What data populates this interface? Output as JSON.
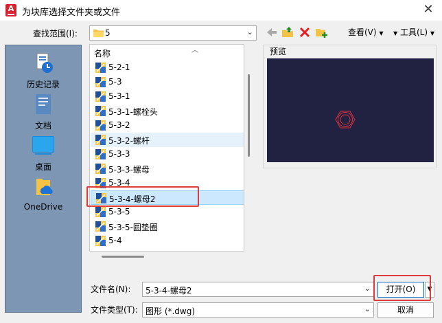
{
  "window": {
    "title": "为块库选择文件夹或文件",
    "app_icon_letter": "A",
    "close_glyph": "✕"
  },
  "toolbar": {
    "lookin_label": "查找范围(I):",
    "lookin_value": "5",
    "view_menu": "查看(V)",
    "tools_menu": "工具(L)",
    "icons": [
      "back-arrow-icon",
      "up-folder-icon",
      "delete-icon",
      "new-folder-icon"
    ]
  },
  "places": [
    {
      "label": "历史记录",
      "icon": "history-icon"
    },
    {
      "label": "文档",
      "icon": "documents-icon"
    },
    {
      "label": "桌面",
      "icon": "desktop-icon"
    },
    {
      "label": "OneDrive",
      "icon": "onedrive-icon"
    }
  ],
  "file_list": {
    "column_header": "名称",
    "files": [
      "5-2-1",
      "5-3",
      "5-3-1",
      "5-3-1-螺栓头",
      "5-3-2",
      "5-3-2-螺杆",
      "5-3-3",
      "5-3-3-螺母",
      "5-3-4",
      "5-3-4-螺母2",
      "5-3-5",
      "5-3-5-圆垫圈",
      "5-4"
    ],
    "hovered": "5-3-2-螺杆",
    "selected": "5-3-4-螺母2"
  },
  "preview": {
    "label": "预览",
    "background": "#212141",
    "shape_color": "#e0323c"
  },
  "bottom": {
    "filename_label": "文件名(N):",
    "filename_value": "5-3-4-螺母2",
    "filetype_label": "文件类型(T):",
    "filetype_value": "图形 (*.dwg)",
    "open_label": "打开(O)",
    "cancel_label": "取消"
  },
  "colors": {
    "highlight": "#e03b3b",
    "sidebar": "#7d96b4",
    "selection": "#cce8ff"
  }
}
